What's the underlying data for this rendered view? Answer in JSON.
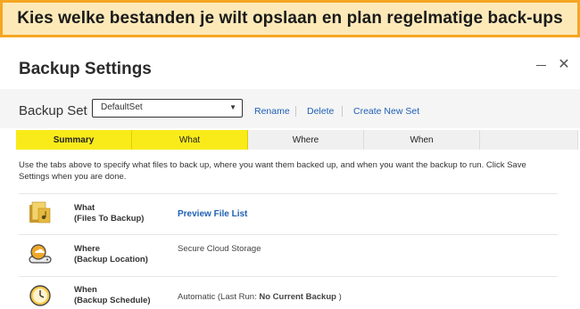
{
  "banner": {
    "text": "Kies welke bestanden je wilt opslaan en plan regelmatige back-ups"
  },
  "window": {
    "title": "Backup Settings",
    "minimize_label": "—",
    "close_label": "✕"
  },
  "backup_set": {
    "label": "Backup Set",
    "selected": "DefaultSet",
    "actions": {
      "rename": "Rename",
      "delete": "Delete",
      "create": "Create New Set"
    }
  },
  "tabs": [
    {
      "label": "Summary"
    },
    {
      "label": "What"
    },
    {
      "label": "Where"
    },
    {
      "label": "When"
    }
  ],
  "description": "Use the tabs above to specify what files to back up, where you want them backed up, and when you want the backup to run. Click Save Settings when you are done.",
  "rows": {
    "what": {
      "title": "What",
      "subtitle": "(Files To Backup)",
      "link": "Preview File List"
    },
    "where": {
      "title": "Where",
      "subtitle": "(Backup Location)",
      "value": "Secure Cloud Storage"
    },
    "when": {
      "title": "When",
      "subtitle": "(Backup Schedule)",
      "value_prefix": "Automatic (Last Run: ",
      "value_bold": "No Current Backup",
      "value_suffix": " )"
    }
  },
  "colors": {
    "banner_border": "#f5a623",
    "banner_fill": "#fde9b8",
    "tab_active": "#f9eb1a",
    "link": "#1f5fb5"
  },
  "icons": [
    "folder-files-icon",
    "cloud-drive-icon",
    "clock-icon",
    "chevron-down-icon",
    "close-icon",
    "minimize-icon"
  ]
}
